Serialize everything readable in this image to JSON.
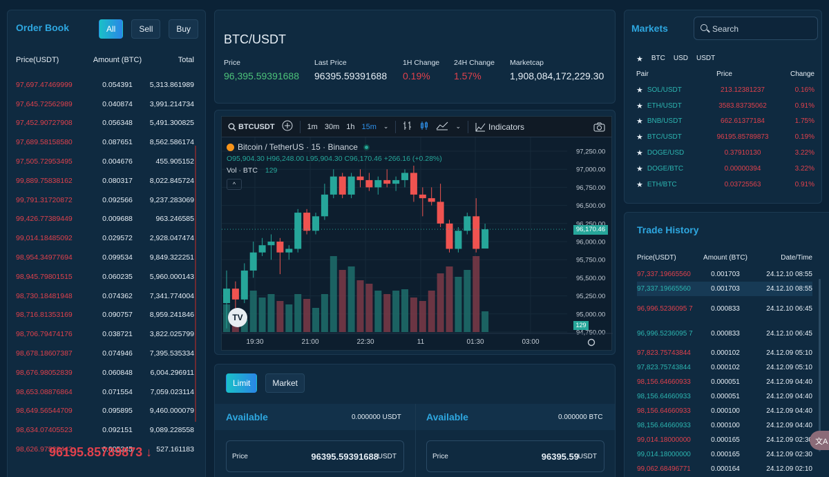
{
  "orderbook": {
    "title": "Order Book",
    "tabs": [
      "All",
      "Sell",
      "Buy"
    ],
    "columns": [
      "Price(USDT)",
      "Amount (BTC)",
      "Total"
    ],
    "rows": [
      [
        "97,697.47469999",
        "0.054391",
        "5,313.861989"
      ],
      [
        "97,645.72562989",
        "0.040874",
        "3,991.214734"
      ],
      [
        "97,452.90727908",
        "0.056348",
        "5,491.300825"
      ],
      [
        "97,689.58158580",
        "0.087651",
        "8,562.586174"
      ],
      [
        "97,505.72953495",
        "0.004676",
        "455.905152"
      ],
      [
        "99,889.75838162",
        "0.080317",
        "8,022.845724"
      ],
      [
        "99,791.31720872",
        "0.092566",
        "9,237.283069"
      ],
      [
        "99,426.77389449",
        "0.009688",
        "963.246585"
      ],
      [
        "99,014.18485092",
        "0.029572",
        "2,928.047474"
      ],
      [
        "98,954.34977694",
        "0.099534",
        "9,849.322251"
      ],
      [
        "98,945.79801515",
        "0.060235",
        "5,960.000143"
      ],
      [
        "98,730.18481948",
        "0.074362",
        "7,341.774004"
      ],
      [
        "98,716.81353169",
        "0.090757",
        "8,959.241846"
      ],
      [
        "98,706.79474176",
        "0.038721",
        "3,822.025799"
      ],
      [
        "98,678.18607387",
        "0.074946",
        "7,395.535334"
      ],
      [
        "98,676.98052839",
        "0.060848",
        "6,004.296911"
      ],
      [
        "98,653.08876864",
        "0.071554",
        "7,059.023114"
      ],
      [
        "98,649.56544709",
        "0.095895",
        "9,460.000079"
      ],
      [
        "98,634.07405523",
        "0.092151",
        "9,089.228558"
      ],
      [
        "98,626.97528443",
        "0.005345",
        "527.161183"
      ]
    ],
    "last_price": "96195.85789873 ↓"
  },
  "ticker": {
    "pair": "BTC/USDT",
    "stats": [
      {
        "label": "Price",
        "value": "96,395.59391688",
        "color": "#4dc37a"
      },
      {
        "label": "Last Price",
        "value": "96395.59391688",
        "color": "#e6eef5"
      },
      {
        "label": "1H Change",
        "value": "0.19%",
        "color": "#e0414c"
      },
      {
        "label": "24H Change",
        "value": "1.57%",
        "color": "#e0414c"
      },
      {
        "label": "Marketcap",
        "value": "1,908,084,172,229.30",
        "color": "#e6eef5"
      }
    ]
  },
  "chart": {
    "toolbar": {
      "symbol": "BTCUSDT",
      "intervals": [
        "1m",
        "30m",
        "1h",
        "15m"
      ],
      "active_interval": "15m",
      "indicators": "Indicators"
    },
    "legend": {
      "name": "Bitcoin / TetherUS · 15 · Binance",
      "ohlc": "O95,904.30 H96,248.00 L95,904.30 C96,170.46 +266.16 (+0.28%)",
      "vol_label": "Vol · BTC",
      "vol_value": "129"
    },
    "last_price_label": "96,170.46",
    "vol_badge": "129"
  },
  "chart_data": {
    "type": "candlestick",
    "y_ticks": [
      "97,250.00",
      "97,000.00",
      "96,750.00",
      "96,500.00",
      "96,250.00",
      "96,000.00",
      "95,750.00",
      "95,500.00",
      "95,250.00",
      "95,000.00",
      "94,750.00"
    ],
    "x_ticks": [
      "19:30",
      "21:00",
      "22:30",
      "11",
      "01:30",
      "03:00"
    ],
    "ylim": [
      94750,
      97250
    ],
    "candles": [
      {
        "o": 95150,
        "h": 95600,
        "l": 94800,
        "c": 95350
      },
      {
        "o": 95350,
        "h": 95450,
        "l": 95000,
        "c": 95200
      },
      {
        "o": 95200,
        "h": 95700,
        "l": 95150,
        "c": 95600
      },
      {
        "o": 95600,
        "h": 96000,
        "l": 95500,
        "c": 95850
      },
      {
        "o": 95850,
        "h": 96050,
        "l": 95800,
        "c": 95950
      },
      {
        "o": 95950,
        "h": 96100,
        "l": 95750,
        "c": 96000
      },
      {
        "o": 96000,
        "h": 96050,
        "l": 95550,
        "c": 95850
      },
      {
        "o": 95850,
        "h": 95950,
        "l": 95750,
        "c": 95900
      },
      {
        "o": 95900,
        "h": 96450,
        "l": 95850,
        "c": 96400
      },
      {
        "o": 96400,
        "h": 96450,
        "l": 96100,
        "c": 96150
      },
      {
        "o": 96150,
        "h": 96400,
        "l": 96100,
        "c": 96350
      },
      {
        "o": 96350,
        "h": 96800,
        "l": 96300,
        "c": 96650
      },
      {
        "o": 96650,
        "h": 97000,
        "l": 96600,
        "c": 96900
      },
      {
        "o": 96900,
        "h": 96950,
        "l": 96600,
        "c": 96650
      },
      {
        "o": 96650,
        "h": 96950,
        "l": 96600,
        "c": 96900
      },
      {
        "o": 96900,
        "h": 97000,
        "l": 96750,
        "c": 96850
      },
      {
        "o": 96850,
        "h": 96950,
        "l": 96700,
        "c": 96750
      },
      {
        "o": 96750,
        "h": 96900,
        "l": 96650,
        "c": 96850
      },
      {
        "o": 96850,
        "h": 97000,
        "l": 96750,
        "c": 96800
      },
      {
        "o": 96800,
        "h": 96900,
        "l": 96700,
        "c": 96850
      },
      {
        "o": 96850,
        "h": 97000,
        "l": 96750,
        "c": 96950
      },
      {
        "o": 96950,
        "h": 97050,
        "l": 96550,
        "c": 96650
      },
      {
        "o": 96650,
        "h": 96750,
        "l": 96350,
        "c": 96600
      },
      {
        "o": 96600,
        "h": 96750,
        "l": 96500,
        "c": 96550
      },
      {
        "o": 96550,
        "h": 96800,
        "l": 96200,
        "c": 96250
      },
      {
        "o": 96250,
        "h": 96300,
        "l": 95850,
        "c": 95900
      },
      {
        "o": 95900,
        "h": 96200,
        "l": 95850,
        "c": 96150
      },
      {
        "o": 96150,
        "h": 96400,
        "l": 96100,
        "c": 96350
      },
      {
        "o": 96350,
        "h": 96600,
        "l": 95850,
        "c": 95900
      },
      {
        "o": 95904.3,
        "h": 96248,
        "l": 95904.3,
        "c": 96170.46
      }
    ],
    "volumes": [
      40,
      25,
      18,
      60,
      50,
      55,
      45,
      40,
      55,
      48,
      35,
      55,
      110,
      90,
      95,
      75,
      70,
      60,
      55,
      60,
      62,
      50,
      45,
      60,
      85,
      95,
      80,
      90,
      110,
      30
    ],
    "last_price": 96170.46
  },
  "form": {
    "tabs": [
      "Limit",
      "Market"
    ],
    "left": {
      "title": "Available",
      "value": "0.000000 USDT",
      "price_label": "Price",
      "price": "96395.59391688",
      "unit": "USDT"
    },
    "right": {
      "title": "Available",
      "value": "0.000000 BTC",
      "price_label": "Price",
      "price": "96395.59",
      "unit": "USDT"
    }
  },
  "markets": {
    "title": "Markets",
    "search_placeholder": "Search",
    "filters": [
      "BTC",
      "USD",
      "USDT"
    ],
    "columns": [
      "Pair",
      "Price",
      "Change"
    ],
    "rows": [
      [
        "SOL/USDT",
        "213.12381237",
        "0.16%"
      ],
      [
        "ETH/USDT",
        "3583.83735062",
        "0.91%"
      ],
      [
        "BNB/USDT",
        "662.61377184",
        "1.75%"
      ],
      [
        "BTC/USDT",
        "96195.85789873",
        "0.19%"
      ],
      [
        "DOGE/USD",
        "0.37910130",
        "3.22%"
      ],
      [
        "DOGE/BTC",
        "0.00000394",
        "3.22%"
      ],
      [
        "ETH/BTC",
        "0.03725563",
        "0.91%"
      ]
    ]
  },
  "history": {
    "title": "Trade History",
    "columns": [
      "Price(USDT)",
      "Amount (BTC)",
      "Date/Time"
    ],
    "rows": [
      {
        "price": "97,337.19665560",
        "amount": "0.001703",
        "time": "24.12.10 08:55",
        "side": "sell"
      },
      {
        "price": "97,337.19665560",
        "amount": "0.001703",
        "time": "24.12.10 08:55",
        "side": "buy",
        "highlight": true
      },
      {
        "price": "96,996.5236095 7",
        "amount": "0.000833",
        "time": "24.12.10 06:45",
        "side": "sell"
      },
      {
        "price": "96,996.5236095 7",
        "amount": "0.000833",
        "time": "24.12.10 06:45",
        "side": "buy"
      },
      {
        "price": "97,823.75743844",
        "amount": "0.000102",
        "time": "24.12.09 05:10",
        "side": "sell"
      },
      {
        "price": "97,823.75743844",
        "amount": "0.000102",
        "time": "24.12.09 05:10",
        "side": "buy"
      },
      {
        "price": "98,156.64660933",
        "amount": "0.000051",
        "time": "24.12.09 04:40",
        "side": "sell"
      },
      {
        "price": "98,156.64660933",
        "amount": "0.000051",
        "time": "24.12.09 04:40",
        "side": "buy"
      },
      {
        "price": "98,156.64660933",
        "amount": "0.000100",
        "time": "24.12.09 04:40",
        "side": "sell"
      },
      {
        "price": "98,156.64660933",
        "amount": "0.000100",
        "time": "24.12.09 04:40",
        "side": "buy"
      },
      {
        "price": "99,014.18000000",
        "amount": "0.000165",
        "time": "24.12.09 02:30",
        "side": "sell"
      },
      {
        "price": "99,014.18000000",
        "amount": "0.000165",
        "time": "24.12.09 02:30",
        "side": "buy"
      },
      {
        "price": "99,062.68496771",
        "amount": "0.000164",
        "time": "24.12.09 02:10",
        "side": "sell"
      }
    ]
  },
  "fab_icon": "translate-icon"
}
